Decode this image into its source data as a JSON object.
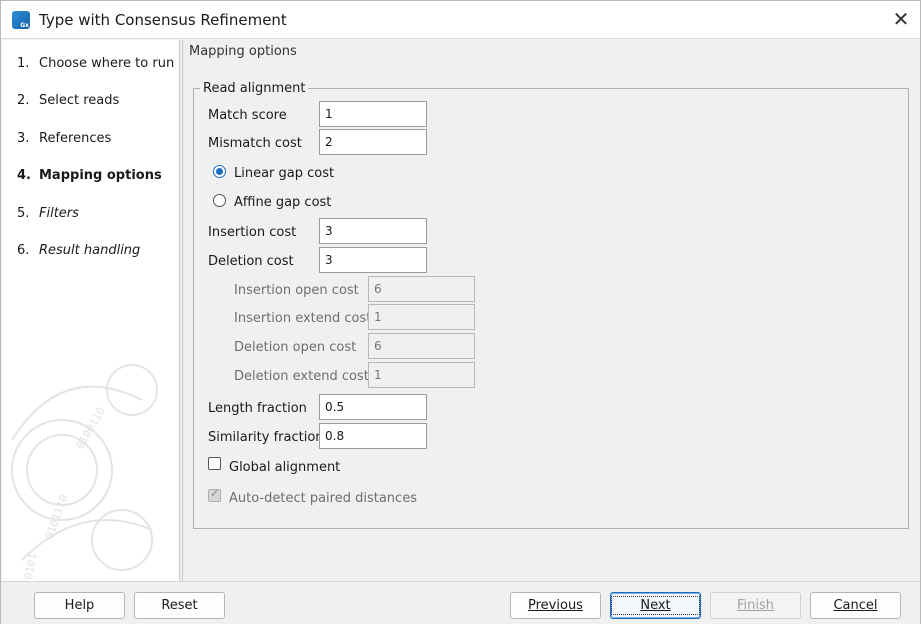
{
  "window": {
    "title": "Type with Consensus Refinement",
    "close_icon": "close-icon"
  },
  "steps": [
    {
      "num": "1.",
      "label": "Choose where to run",
      "state": "done"
    },
    {
      "num": "2.",
      "label": "Select reads",
      "state": "done"
    },
    {
      "num": "3.",
      "label": "References",
      "state": "done"
    },
    {
      "num": "4.",
      "label": "Mapping options",
      "state": "active"
    },
    {
      "num": "5.",
      "label": "Filters",
      "state": "future"
    },
    {
      "num": "6.",
      "label": "Result handling",
      "state": "future"
    }
  ],
  "content": {
    "header": "Mapping options",
    "group": {
      "legend": "Read alignment",
      "match_score": {
        "label": "Match score",
        "value": "1"
      },
      "mismatch_cost": {
        "label": "Mismatch cost",
        "value": "2"
      },
      "linear_gap": {
        "label": "Linear gap cost",
        "checked": true
      },
      "affine_gap": {
        "label": "Affine gap cost",
        "checked": false
      },
      "insertion_cost": {
        "label": "Insertion cost",
        "value": "3"
      },
      "deletion_cost": {
        "label": "Deletion cost",
        "value": "3"
      },
      "insertion_open_cost": {
        "label": "Insertion open cost",
        "value": "6"
      },
      "insertion_extend_cost": {
        "label": "Insertion extend cost",
        "value": "1"
      },
      "deletion_open_cost": {
        "label": "Deletion open cost",
        "value": "6"
      },
      "deletion_extend_cost": {
        "label": "Deletion extend cost",
        "value": "1"
      },
      "length_fraction": {
        "label": "Length fraction",
        "value": "0.5"
      },
      "similarity_fraction": {
        "label": "Similarity fraction",
        "value": "0.8"
      },
      "global_alignment": {
        "label": "Global alignment",
        "checked": false
      },
      "auto_detect": {
        "label": "Auto-detect paired distances",
        "checked": true,
        "disabled": true
      }
    }
  },
  "buttons": {
    "help": "Help",
    "reset": "Reset",
    "previous": "Previous",
    "next": "Next",
    "finish": "Finish",
    "cancel": "Cancel"
  },
  "colors": {
    "accent": "#1a6fc4"
  }
}
